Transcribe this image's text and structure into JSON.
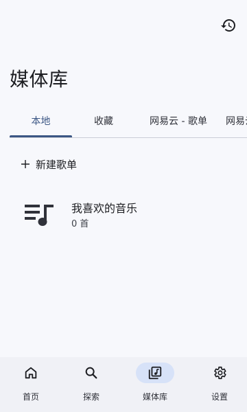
{
  "header": {
    "title": "媒体库",
    "history_icon": "history-icon"
  },
  "tabs": [
    {
      "label": "本地",
      "active": true
    },
    {
      "label": "收藏",
      "active": false
    },
    {
      "label": "网易云 - 歌单",
      "active": false
    },
    {
      "label": "网易云",
      "active": false
    }
  ],
  "actions": {
    "new_playlist_label": "新建歌单",
    "new_playlist_icon": "plus-icon"
  },
  "playlists": [
    {
      "name": "我喜欢的音乐",
      "count": "0 首",
      "icon": "playlist-icon"
    }
  ],
  "bottom_nav": [
    {
      "label": "首页",
      "icon": "home-icon",
      "active": false
    },
    {
      "label": "探索",
      "icon": "search-icon",
      "active": false
    },
    {
      "label": "媒体库",
      "icon": "library-icon",
      "active": true
    },
    {
      "label": "设置",
      "icon": "gear-icon",
      "active": false
    }
  ],
  "colors": {
    "accent": "#3b5684",
    "active_nav_bg": "#d7e2f8",
    "background": "#f7f8fc"
  }
}
